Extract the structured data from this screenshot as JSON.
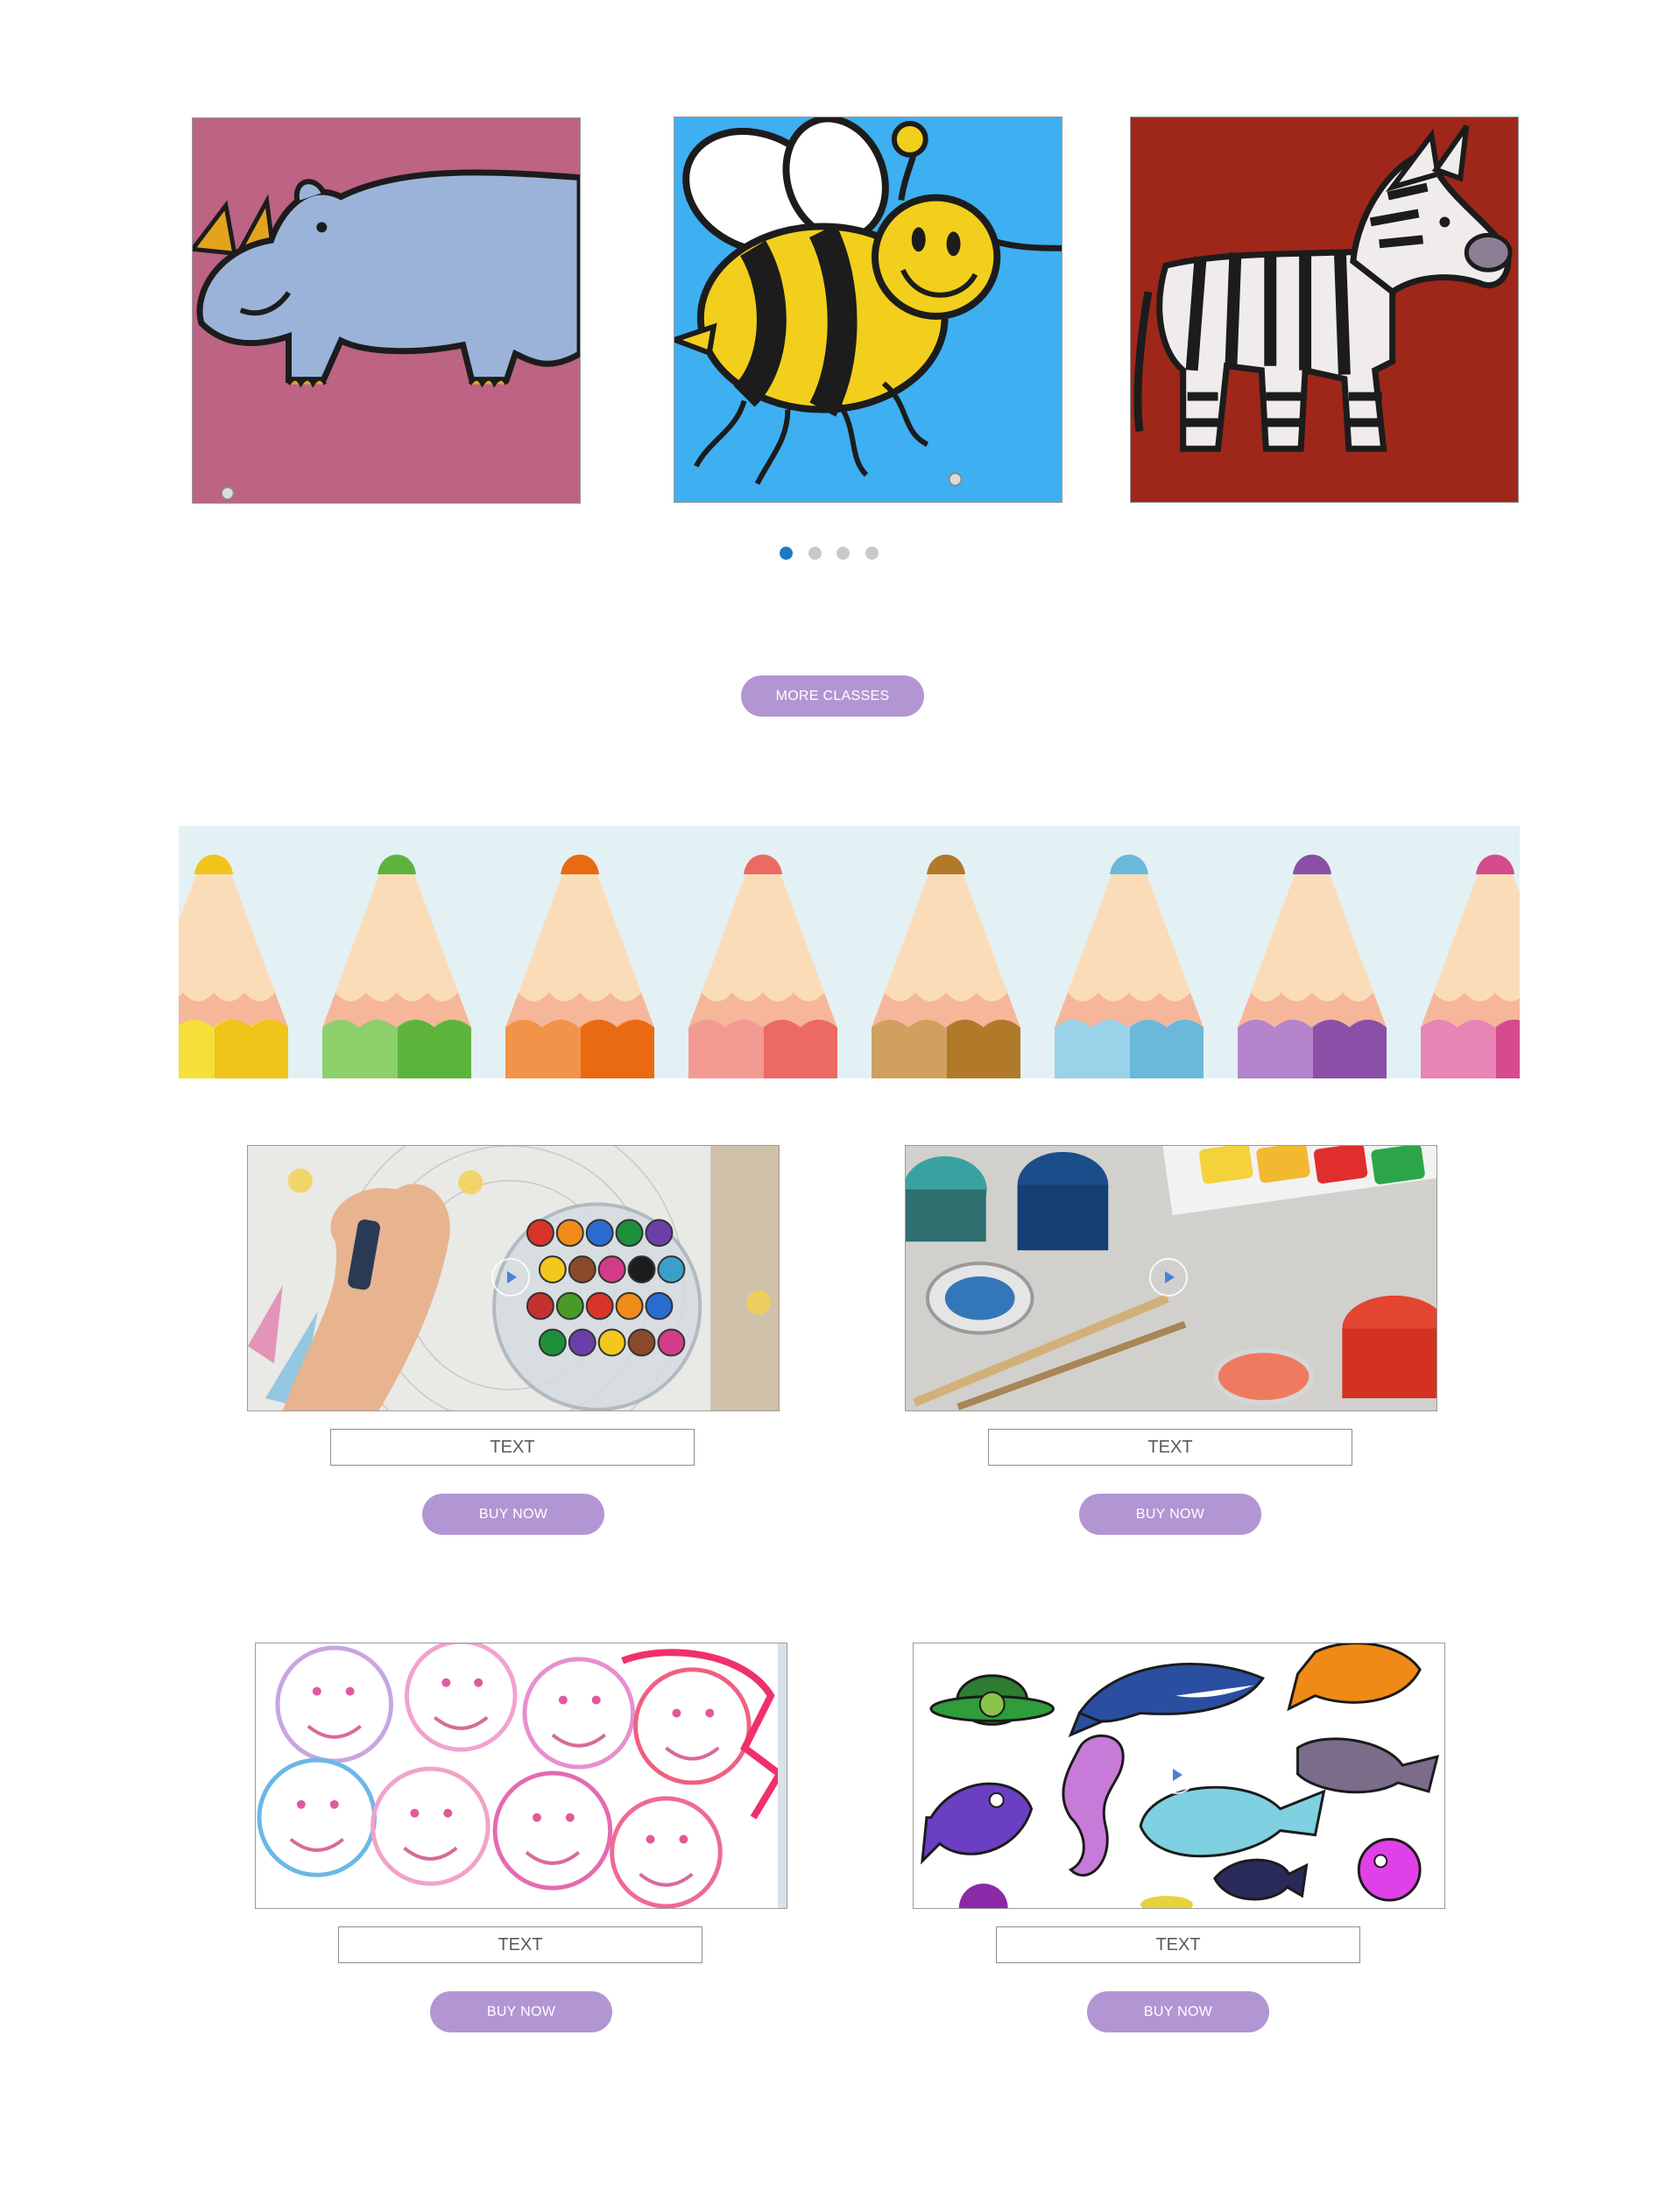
{
  "carousel": {
    "slides": [
      {
        "subject": "rhino painting"
      },
      {
        "subject": "bee painting"
      },
      {
        "subject": "zebra painting"
      }
    ],
    "dots": 4,
    "active_dot": 0
  },
  "more_classes_label": "MORE CLASSES",
  "banner": {
    "subject": "colored pencil tips"
  },
  "products": [
    {
      "image": "crayons-in-jar",
      "text": "TEXT",
      "button": "BUY NOW"
    },
    {
      "image": "paint-pots-brushes",
      "text": "TEXT",
      "button": "BUY NOW"
    },
    {
      "image": "watercolor-kids-faces",
      "text": "TEXT",
      "button": "BUY NOW"
    },
    {
      "image": "cartoon-sea-animals",
      "text": "TEXT",
      "button": "BUY NOW"
    }
  ],
  "colors": {
    "accent": "#b296d3",
    "active_dot": "#1f79c1",
    "inactive_dot": "#c9c9c9"
  }
}
